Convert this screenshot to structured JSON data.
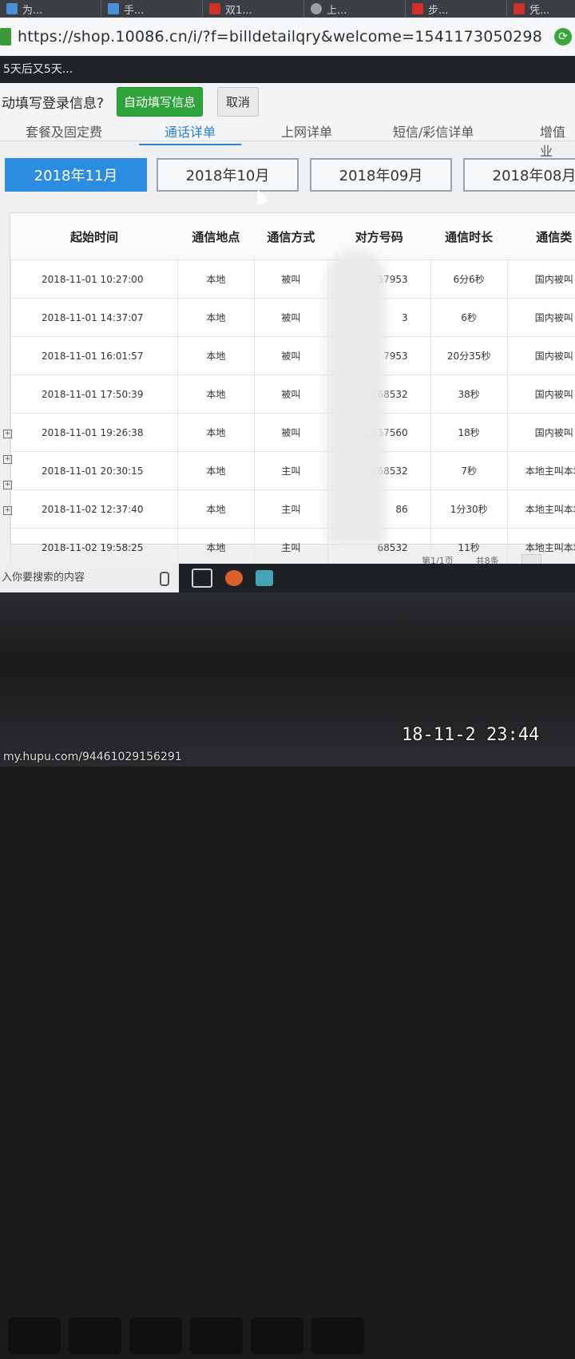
{
  "browser": {
    "tabs": [
      {
        "label": "为...",
        "icon": "site-icon"
      },
      {
        "label": "手...",
        "icon": "site-icon"
      },
      {
        "label": "双1...",
        "icon": "red-site-icon"
      },
      {
        "label": "上...",
        "icon": "gear-icon"
      },
      {
        "label": "步...",
        "icon": "tiger-icon"
      },
      {
        "label": "凭...",
        "icon": "tiger-icon"
      }
    ],
    "url": "https://shop.10086.cn/i/?f=billdetailqry&welcome=1541173050298",
    "notice": "5天后又5天..."
  },
  "autofill": {
    "question": "动填写登录信息?",
    "autofill_button": "自动填写信息",
    "cancel_button": "取消"
  },
  "tabs": [
    {
      "label": "套餐及固定费"
    },
    {
      "label": "通话详单",
      "active": true
    },
    {
      "label": "上网详单"
    },
    {
      "label": "短信/彩信详单"
    },
    {
      "label": "增值业"
    }
  ],
  "months": [
    {
      "label": "2018年11月",
      "active": true
    },
    {
      "label": "2018年10月"
    },
    {
      "label": "2018年09月"
    },
    {
      "label": "2018年08月"
    }
  ],
  "table": {
    "headers": [
      "起始时间",
      "通信地点",
      "通信方式",
      "对方号码",
      "通信时长",
      "通信类"
    ],
    "rows": [
      [
        "2018-11-01 10:27:00",
        "本地",
        "被叫",
        "57953",
        "6分6秒",
        "国内被叫"
      ],
      [
        "2018-11-01 14:37:07",
        "本地",
        "被叫",
        "3",
        "6秒",
        "国内被叫"
      ],
      [
        "2018-11-01 16:01:57",
        "本地",
        "被叫",
        "7953",
        "20分35秒",
        "国内被叫"
      ],
      [
        "2018-11-01 17:50:39",
        "本地",
        "被叫",
        "568532",
        "38秒",
        "国内被叫"
      ],
      [
        "2018-11-01 19:26:38",
        "本地",
        "被叫",
        "5557560",
        "18秒",
        "国内被叫"
      ],
      [
        "2018-11-01 20:30:15",
        "本地",
        "主叫",
        "568532",
        "7秒",
        "本地主叫本地"
      ],
      [
        "2018-11-02 12:37:40",
        "本地",
        "主叫",
        "86",
        "1分30秒",
        "本地主叫本地"
      ],
      [
        "2018-11-02 19:58:25",
        "本地",
        "主叫",
        "68532",
        "11秒",
        "本地主叫本地"
      ]
    ]
  },
  "pager": {
    "page": "第1/1页",
    "count": "共8条"
  },
  "taskbar": {
    "search_placeholder": "入你要搜索的内容"
  },
  "photo": {
    "timestamp": "18-11-2 23:44",
    "watermark": "my.hupu.com/94461029156291"
  }
}
